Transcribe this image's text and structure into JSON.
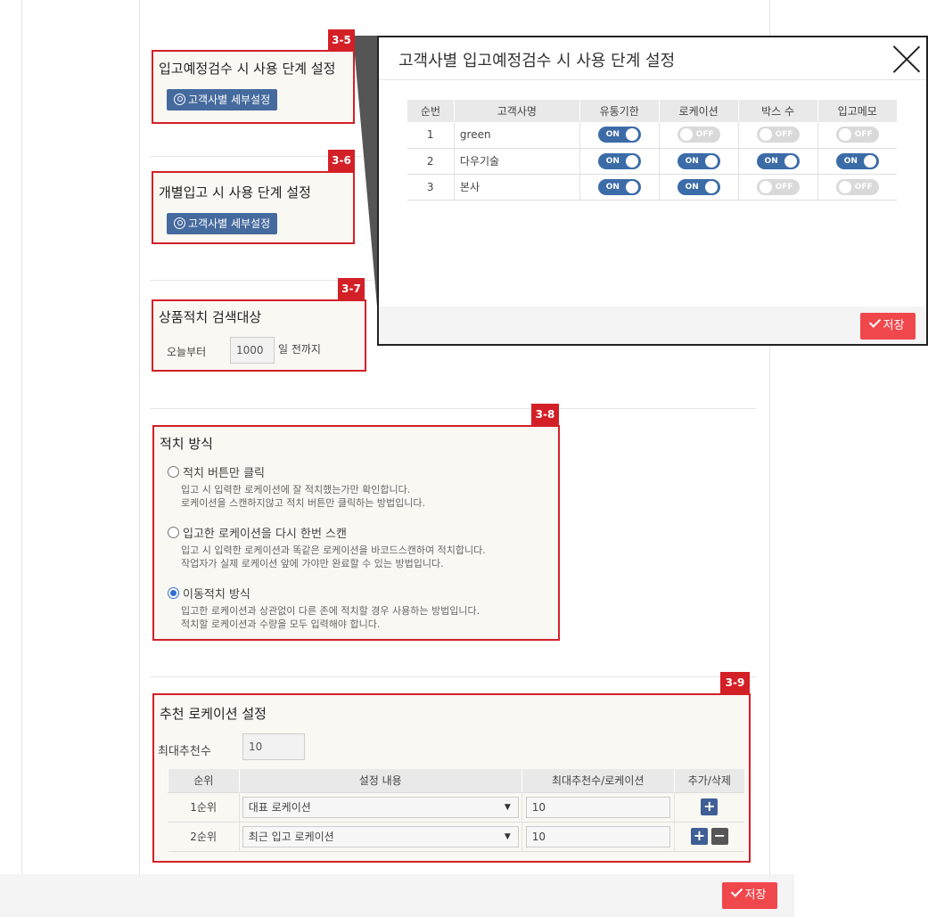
{
  "sections": {
    "s35": {
      "badge": "3-5",
      "title": "입고예정검수 시 사용 단계 설정",
      "button": "고객사별 세부설정"
    },
    "s36": {
      "badge": "3-6",
      "title": "개별입고 시 사용 단계 설정",
      "button": "고객사별 세부설정"
    },
    "s37": {
      "badge": "3-7",
      "title": "상품적치 검색대상",
      "prefix": "오늘부터",
      "value": "1000",
      "suffix": "일 전까지"
    },
    "s38": {
      "badge": "3-8",
      "title": "적치 방식",
      "options": [
        {
          "label": "적치 버튼만 클릭",
          "desc1": "입고 시 입력한 로케이션에 잘 적치했는가만 확인합니다.",
          "desc2": "로케이션을 스캔하지않고 적치 버튼만 클릭하는 방법입니다.",
          "selected": false
        },
        {
          "label": "입고한 로케이션을 다시 한번 스캔",
          "desc1": "입고 시 입력한 로케이션과 똑같은 로케이션을 바코드스캔하여 적치합니다.",
          "desc2": "작업자가 실제 로케이션 앞에 가야만 완료할 수 있는 방법입니다.",
          "selected": false
        },
        {
          "label": "이동적치 방식",
          "desc1": "입고한 로케이션과 상관없이 다른 존에 적치할 경우 사용하는 방법입니다.",
          "desc2": "적치할 로케이션과 수량을 모두 입력해야 합니다.",
          "selected": true
        }
      ]
    },
    "s39": {
      "badge": "3-9",
      "title": "추천 로케이션 설정",
      "max_label": "최대추천수",
      "max_value": "10",
      "columns": [
        "순위",
        "설정 내용",
        "최대추천수/로케이션",
        "추가/삭제"
      ],
      "rows": [
        {
          "rank": "1순위",
          "setting": "대표 로케이션",
          "value": "10"
        },
        {
          "rank": "2순위",
          "setting": "최근 입고 로케이션",
          "value": "10"
        }
      ]
    }
  },
  "save_label": "저장",
  "modal": {
    "title": "고객사별 입고예정검수 시 사용 단계 설정",
    "columns": [
      "순번",
      "고객사명",
      "유통기한",
      "로케이션",
      "박스 수",
      "입고메모"
    ],
    "rows": [
      {
        "no": "1",
        "name": "green",
        "toggles": [
          "ON",
          "OFF",
          "OFF",
          "OFF"
        ]
      },
      {
        "no": "2",
        "name": "다우기술",
        "toggles": [
          "ON",
          "ON",
          "ON",
          "ON"
        ]
      },
      {
        "no": "3",
        "name": "본사",
        "toggles": [
          "ON",
          "ON",
          "OFF",
          "OFF"
        ]
      }
    ],
    "save_label": "저장"
  },
  "colors": {
    "accent_red": "#d32027",
    "button_blue": "#456a9e",
    "save_red": "#f0474c",
    "toggle_on": "#3c6ca8"
  },
  "icons": [
    "user-circle-icon",
    "close-icon",
    "check-icon",
    "plus-icon",
    "minus-icon",
    "caret-down-icon"
  ]
}
